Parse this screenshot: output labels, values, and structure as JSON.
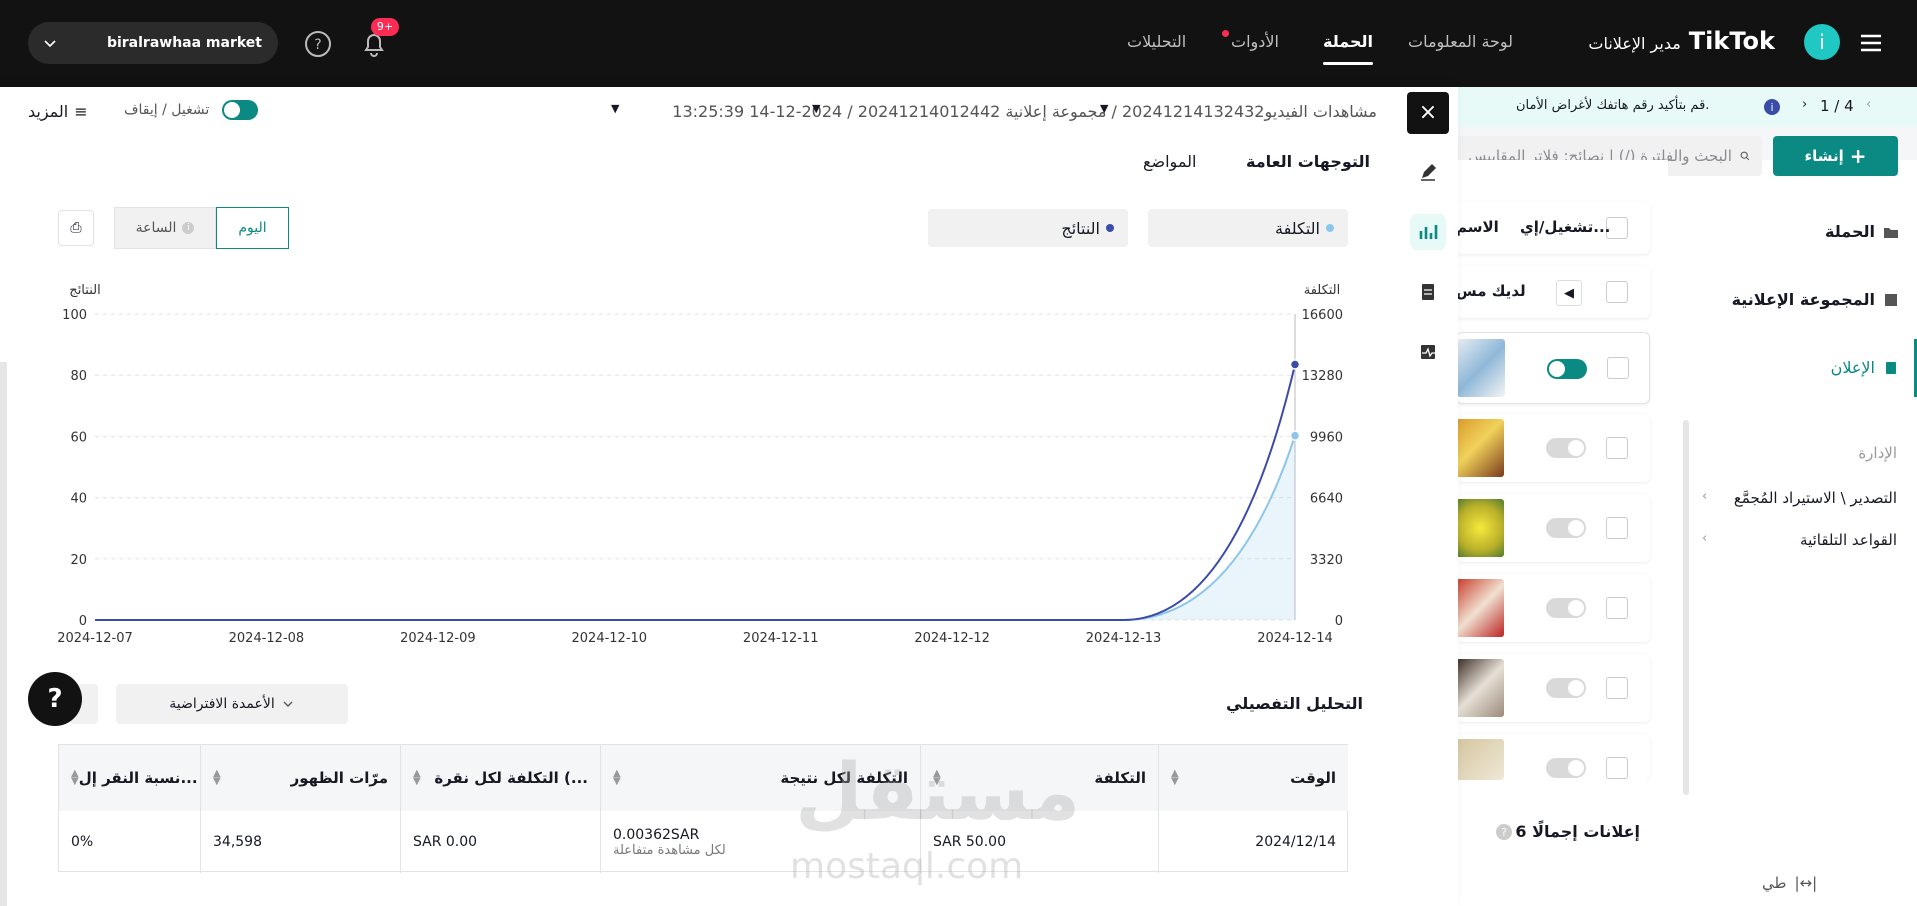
{
  "topbar": {
    "account": "biralrawhaa market",
    "badge": "9+",
    "nav": [
      {
        "label": "التحليلات"
      },
      {
        "label": "الأدوات"
      },
      {
        "label": "الحملة"
      },
      {
        "label": "لوحة المعلومات"
      }
    ],
    "brand_prefix": "مدير الإعلانات",
    "brand": "TikTok",
    "avatar": "i"
  },
  "notice": {
    "page": "1 / 4",
    "text": "قم بتأكيد رقم هاتفك لأغراض الأمان."
  },
  "toolbar": {
    "create": "إنشاء",
    "search_placeholder": "البحث والفلترة (/) | نصائح: فلاتر المقاييس"
  },
  "rightnav": {
    "items": [
      {
        "label": "الحملة"
      },
      {
        "label": "المجموعة الإعلانية"
      },
      {
        "label": "الإعلان"
      }
    ],
    "section": "الإدارة",
    "subitems": [
      {
        "label": "التصدير \\ الاستيراد المُجمَّع"
      },
      {
        "label": "القواعد التلقائية"
      }
    ],
    "collapse": "طي"
  },
  "list": {
    "col_status": "تشغيل/إي...",
    "col_name": "الاسم",
    "row_text": "لديك مس",
    "total": "6 إعلانات إجمالًا"
  },
  "drawer": {
    "breadcrumb": "مشاهدات الفيديو20241214132432 / مجموعة إعلانية 20241214012442 / 2024-12-14 13:25:39",
    "more": "المزيد",
    "switch_label": "تشغيل / إيقاف",
    "tabs": [
      {
        "label": "التوجهات العامة"
      },
      {
        "label": "المواضع"
      }
    ],
    "metric_left": "النتائج",
    "metric_right": "التكلفة",
    "seg_day": "اليوم",
    "seg_hour": "الساعة",
    "detail_title": "التحليل التفصيلي",
    "columns_btn": "الأعمدة الافتراضية"
  },
  "chart_data": {
    "type": "line",
    "x": [
      "2024-12-07",
      "2024-12-08",
      "2024-12-09",
      "2024-12-10",
      "2024-12-11",
      "2024-12-12",
      "2024-12-13",
      "2024-12-14"
    ],
    "left_axis_label": "النتائج",
    "right_axis_label": "التكلفة",
    "left_ticks": [
      "100",
      "80",
      "60",
      "40",
      "20",
      "0"
    ],
    "right_ticks": [
      "16600",
      "13280",
      "9960",
      "6640",
      "3320",
      "0"
    ],
    "ylim_left": [
      0,
      100
    ],
    "ylim_right": [
      0,
      16600
    ],
    "series": [
      {
        "name": "النتائج",
        "axis": "left",
        "color": "#3b4ba8",
        "values": [
          0,
          0,
          0,
          0,
          0,
          0,
          0,
          83.5
        ]
      },
      {
        "name": "التكلفة",
        "axis": "right",
        "color": "#8dc6ea",
        "values": [
          0,
          0,
          0,
          0,
          0,
          0,
          0,
          10000
        ]
      }
    ]
  },
  "table": {
    "headers": [
      {
        "label": "الوقت"
      },
      {
        "label": "التكلفة"
      },
      {
        "label": "التكلفة لكل نتيجة"
      },
      {
        "label": "التكلفة لكل نقرة (..."
      },
      {
        "label": "مرّات الظهور"
      },
      {
        "label": "نسبة النقر إل..."
      }
    ],
    "row": {
      "time": "2024/12/14",
      "cost": "SAR 50.00",
      "cpr": "0.00362SAR",
      "cpr_sub": "لكل مشاهدة متفاعلة",
      "cpc": "SAR 0.00",
      "impr": "34,598",
      "ctr": "0%"
    }
  },
  "watermark": {
    "main": "مستقل",
    "sub": "mostaql.com"
  },
  "colors": {
    "accent": "#0b8a83",
    "topbar": "#121212",
    "badge": "#fe2c55"
  }
}
